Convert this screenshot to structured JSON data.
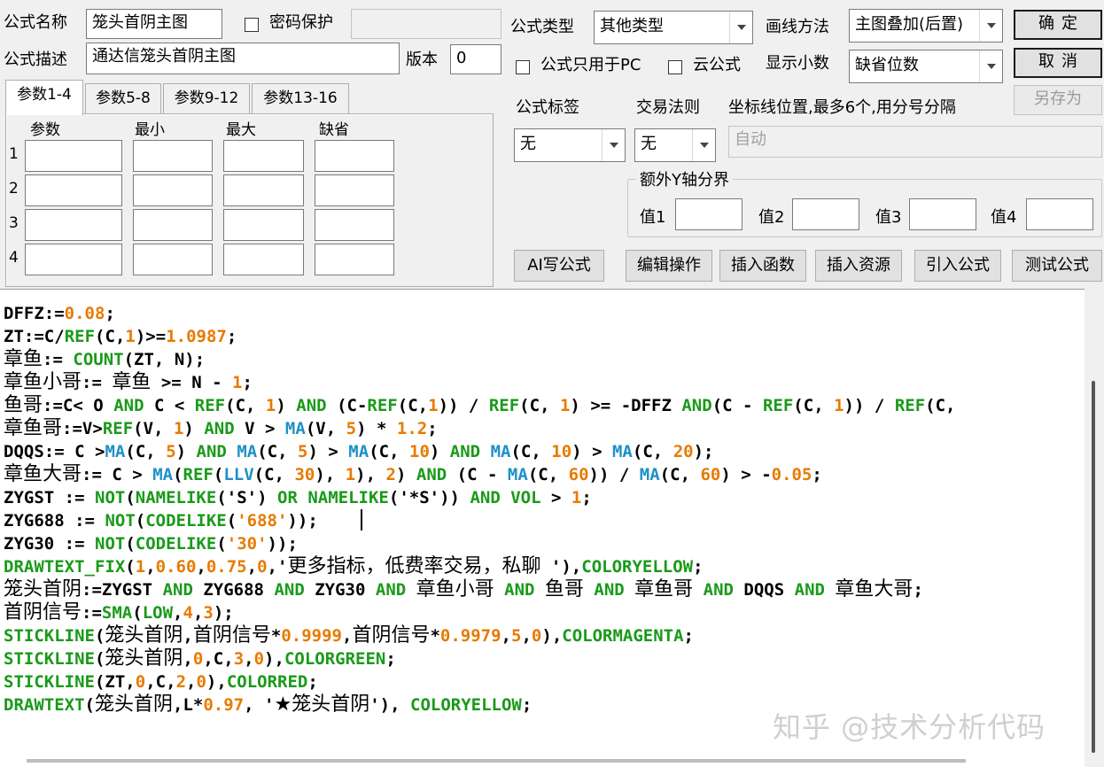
{
  "header": {
    "formula_name_label": "公式名称",
    "formula_name_value": "笼头首阴主图",
    "password_label": "密码保护",
    "password_value": "",
    "formula_desc_label": "公式描述",
    "formula_desc_value": "通达信笼头首阴主图",
    "version_label": "版本",
    "version_value": "0",
    "formula_type_label": "公式类型",
    "formula_type_value": "其他类型",
    "draw_method_label": "画线方法",
    "draw_method_value": "主图叠加(后置)",
    "pc_only_label": "公式只用于PC",
    "cloud_label": "云公式",
    "decimals_label": "显示小数",
    "decimals_value": "缺省位数",
    "ok_label": "确定",
    "cancel_label": "取消",
    "save_as_label": "另存为"
  },
  "params": {
    "tabs": [
      "参数1-4",
      "参数5-8",
      "参数9-12",
      "参数13-16"
    ],
    "columns": [
      "参数",
      "最小",
      "最大",
      "缺省"
    ],
    "rows": [
      "1",
      "2",
      "3",
      "4"
    ]
  },
  "right_panel": {
    "tag_label": "公式标签",
    "tag_value": "无",
    "rule_label": "交易法则",
    "rule_value": "无",
    "axis_label": "坐标线位置,最多6个,用分号分隔",
    "axis_placeholder": "自动",
    "yaxis_group_label": "额外Y轴分界",
    "value_labels": [
      "值1",
      "值2",
      "值3",
      "值4"
    ]
  },
  "toolbar": {
    "ai_label": "AI写公式",
    "edit_label": "编辑操作",
    "insert_func_label": "插入函数",
    "insert_res_label": "插入资源",
    "import_label": "引入公式",
    "test_label": "测试公式"
  },
  "editor": {
    "lines": [
      "DFFZ:=0.08;",
      "ZT:=C/REF(C,1)>=1.0987;",
      "章鱼:= COUNT(ZT, N);",
      "章鱼小哥:= 章鱼 >= N - 1;",
      "鱼哥:=C< O AND C < REF(C, 1) AND (C-REF(C,1)) / REF(C, 1) >= -DFFZ AND(C - REF(C, 1)) / REF(C,",
      "章鱼哥:=V>REF(V, 1) AND V > MA(V, 5) * 1.2;",
      "DQQS:= C >MA(C, 5) AND MA(C, 5) > MA(C, 10) AND MA(C, 10) > MA(C, 20);",
      "章鱼大哥:= C > MA(REF(LLV(C, 30), 1), 2) AND (C - MA(C, 60)) / MA(C, 60) > -0.05;",
      "ZYGST := NOT(NAMELIKE('S') OR NAMELIKE('*S')) AND VOL > 1;",
      "ZYG688 := NOT(CODELIKE('688'));",
      "ZYG30 := NOT(CODELIKE('30'));",
      "DRAWTEXT_FIX(1,0.60,0.75,0,'更多指标，低费率交易，私聊 '),COLORYELLOW;",
      "笼头首阴:=ZYGST AND ZYG688 AND ZYG30 AND 章鱼小哥 AND 鱼哥 AND 章鱼哥 AND DQQS AND 章鱼大哥;",
      "首阴信号:=SMA(LOW,4,3);",
      "STICKLINE(笼头首阴,首阴信号*0.9999,首阴信号*0.9979,5,0),COLORMAGENTA;",
      "STICKLINE(笼头首阴,0,C,3,0),COLORGREEN;",
      "STICKLINE(ZT,0,C,2,0),COLORRED;",
      "DRAWTEXT(笼头首阴,L*0.97, '★笼头首阴'), COLORYELLOW;"
    ]
  },
  "watermark": "知乎 @技术分析代码",
  "colors": {
    "keyword": "#1a9a1a",
    "number": "#e87a00",
    "function": "#1e90c8",
    "text": "#000000"
  }
}
